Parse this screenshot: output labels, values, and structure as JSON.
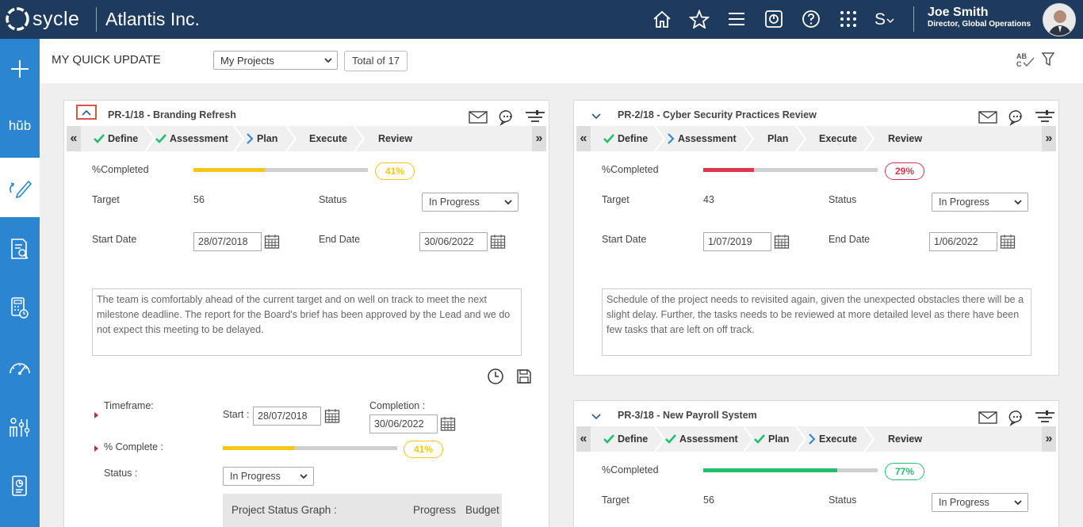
{
  "app": {
    "logo_text": "sycle",
    "company": "Atlantis Inc.",
    "user_name": "Joe Smith",
    "user_role": "Director, Global Operations",
    "top_icons": [
      "home-icon",
      "star-icon",
      "menu-icon",
      "help-circle-icon",
      "question-icon",
      "apps-grid-icon",
      "s-switch-icon"
    ],
    "sidebar_hub_label": "hŭb"
  },
  "header": {
    "title": "MY QUICK UPDATE",
    "project_filter": "My Projects",
    "total": "Total of 17"
  },
  "labels": {
    "completed": "%Completed",
    "target": "Target",
    "status": "Status",
    "start_date": "Start Date",
    "end_date": "End Date",
    "timeframe": "Timeframe:",
    "start": "Start :",
    "completion": "Completion :",
    "pct_complete": "% Complete :",
    "status_colon": "Status :",
    "graph_title": "Project Status Graph :",
    "graph_progress": "Progress",
    "graph_budget": "Budget"
  },
  "projects": [
    {
      "title": "PR-1/18 - Branding Refresh",
      "steps": [
        {
          "label": "Define",
          "state": "done"
        },
        {
          "label": "Assessment",
          "state": "done"
        },
        {
          "label": "Plan",
          "state": "current"
        },
        {
          "label": "Execute",
          "state": "todo"
        },
        {
          "label": "Review",
          "state": "todo"
        }
      ],
      "completed": 41,
      "completed_label": "41%",
      "color": "#f5c518",
      "target": "56",
      "status": "In Progress",
      "start_date": "28/07/2018",
      "end_date": "30/06/2022",
      "note": "The team is comfortably ahead of the current target and on well on track to meet the next milestone deadline. The report for the Board's brief has been approved by the Lead and we do not expect this meeting to be delayed.",
      "expanded": {
        "start": "28/07/2018",
        "completion": "30/06/2022",
        "pct": 41,
        "pct_label": "41%",
        "status": "In Progress"
      }
    },
    {
      "title": "PR-2/18 - Cyber Security Practices Review",
      "steps": [
        {
          "label": "Define",
          "state": "done"
        },
        {
          "label": "Assessment",
          "state": "current"
        },
        {
          "label": "Plan",
          "state": "todo"
        },
        {
          "label": "Execute",
          "state": "todo"
        },
        {
          "label": "Review",
          "state": "todo"
        }
      ],
      "completed": 29,
      "completed_label": "29%",
      "color": "#e0344a",
      "target": "43",
      "status": "In Progress",
      "start_date": "1/07/2019",
      "end_date": "1/06/2022",
      "note": "Schedule of the project needs to revisited again, given the unexpected obstacles there will be a slight delay. Further, the tasks needs to be reviewed at more detailed level as there have been few tasks that are left on off track."
    },
    {
      "title": "PR-3/18 - New Payroll System",
      "steps": [
        {
          "label": "Define",
          "state": "done"
        },
        {
          "label": "Assessment",
          "state": "done"
        },
        {
          "label": "Plan",
          "state": "done"
        },
        {
          "label": "Execute",
          "state": "current"
        },
        {
          "label": "Review",
          "state": "todo"
        }
      ],
      "completed": 77,
      "completed_label": "77%",
      "color": "#1fbf6e",
      "target": "56",
      "status": "In Progress"
    }
  ]
}
